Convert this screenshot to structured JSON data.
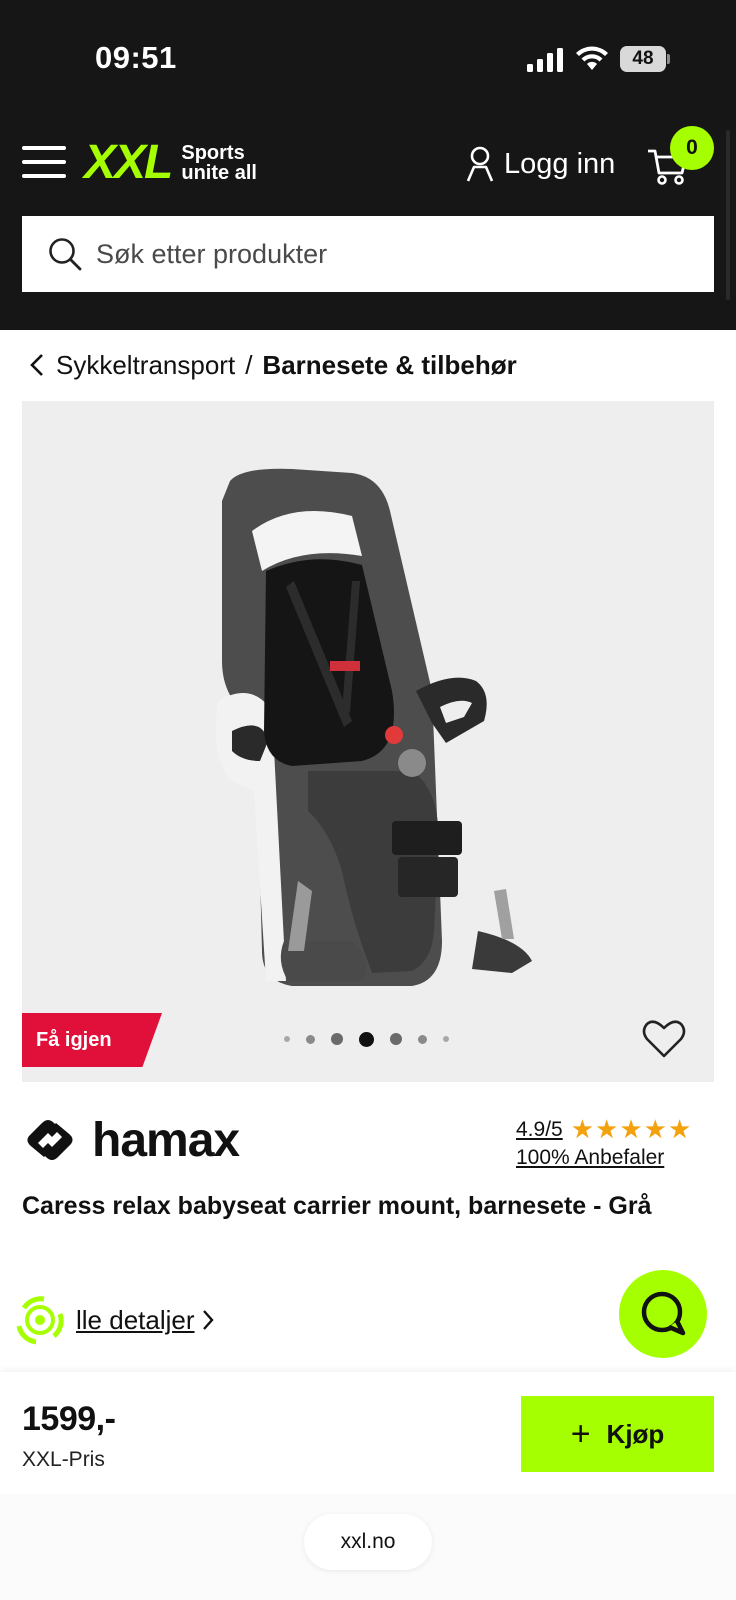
{
  "status_bar": {
    "time": "09:51",
    "battery": "48"
  },
  "header": {
    "logo_text": "XXL",
    "logo_tagline_1": "Sports",
    "logo_tagline_2": "unite all",
    "login_label": "Logg inn",
    "cart_count": "0",
    "search_placeholder": "Søk etter produkter",
    "accent_color": "#a6ff00"
  },
  "breadcrumb": {
    "parent": "Sykkeltransport",
    "separator": "/",
    "current": "Barnesete & tilbehør"
  },
  "gallery": {
    "badge": "Få igjen",
    "badge_color": "#e0103a",
    "image_count": 7,
    "active_index": 3
  },
  "product": {
    "brand": "hamax",
    "rating": "4.9/5",
    "stars": "★★★★★",
    "recommend": "100% Anbefaler",
    "title": "Caress relax babyseat carrier mount, barnesete - Grå",
    "details_link": "lle detaljer"
  },
  "buy_bar": {
    "price": "1599,-",
    "price_label": "XXL-Pris",
    "buy_label": "Kjøp"
  },
  "browser": {
    "url": "xxl.no"
  }
}
